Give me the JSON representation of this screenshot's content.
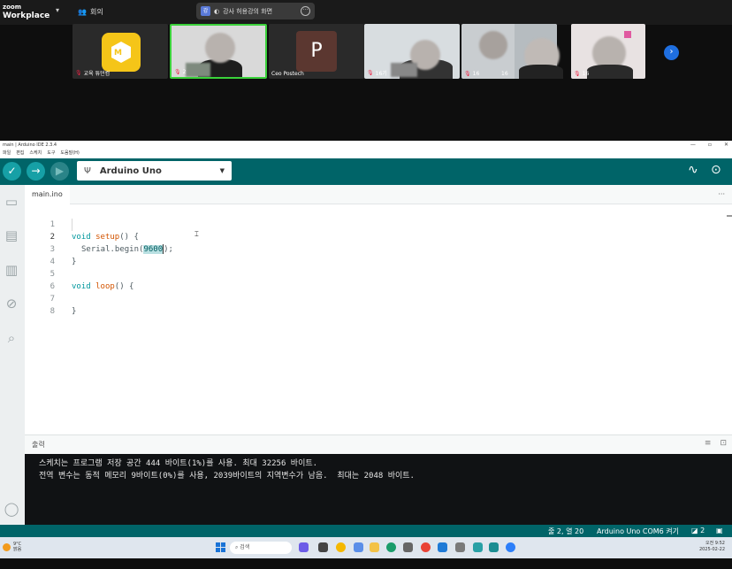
{
  "zoom": {
    "brand_line1": "zoom",
    "brand_line2": "Workplace",
    "meeting_label": "회의",
    "share_badge": "강",
    "share_text": "강사 허용강의 화면",
    "participants": [
      {
        "name": "교육 튜던컴",
        "muted": true
      },
      {
        "name": "2",
        "muted": true
      },
      {
        "name": "Ceo Postech",
        "muted": false,
        "initial": "P"
      },
      {
        "name": "16기",
        "muted": true
      },
      {
        "name": "16",
        "muted": true
      },
      {
        "name": "16",
        "muted": true
      },
      {
        "name": "16",
        "muted": true
      }
    ]
  },
  "ide": {
    "title": "main | Arduino IDE 2.3.4",
    "menu": [
      "파일",
      "편집",
      "스케치",
      "도구",
      "도움말(H)"
    ],
    "board": "Arduino Uno",
    "tab": "main.ino",
    "code_lines": [
      "1",
      "2",
      "3",
      "4",
      "5",
      "6",
      "7",
      "8"
    ],
    "code": {
      "l1_kw": "void",
      "l1_fn": "setup",
      "l1_rest": "() {",
      "l2_fn": "Serial.begin(",
      "l2_num": "9600",
      "l2_rest": ");",
      "l3": "}",
      "l5_kw": "void",
      "l5_fn": "loop",
      "l5_rest": "() {",
      "l7": "}"
    },
    "output_title": "출력",
    "console": [
      "스케치는 프로그램 저장 공간 444 바이트(1%)를 사용. 최대 32256 바이트.",
      "전역 변수는 동적 메모리 9바이트(0%)를 사용, 2039바이트의 지역변수가 남음.  최대는 2048 바이트."
    ],
    "status": {
      "position": "줄 2, 열 20",
      "board_port": "Arduino Uno COM6 켜기",
      "notifications": "2"
    }
  },
  "taskbar": {
    "weather_temp": "9°C",
    "weather_desc": "맑음",
    "search_placeholder": "검색",
    "time": "오전 9:52",
    "date": "2025-02-22"
  },
  "colors": {
    "ide_teal": "#006468",
    "button_teal": "#16a0a6",
    "keyword": "#00979d",
    "function": "#d35400"
  }
}
